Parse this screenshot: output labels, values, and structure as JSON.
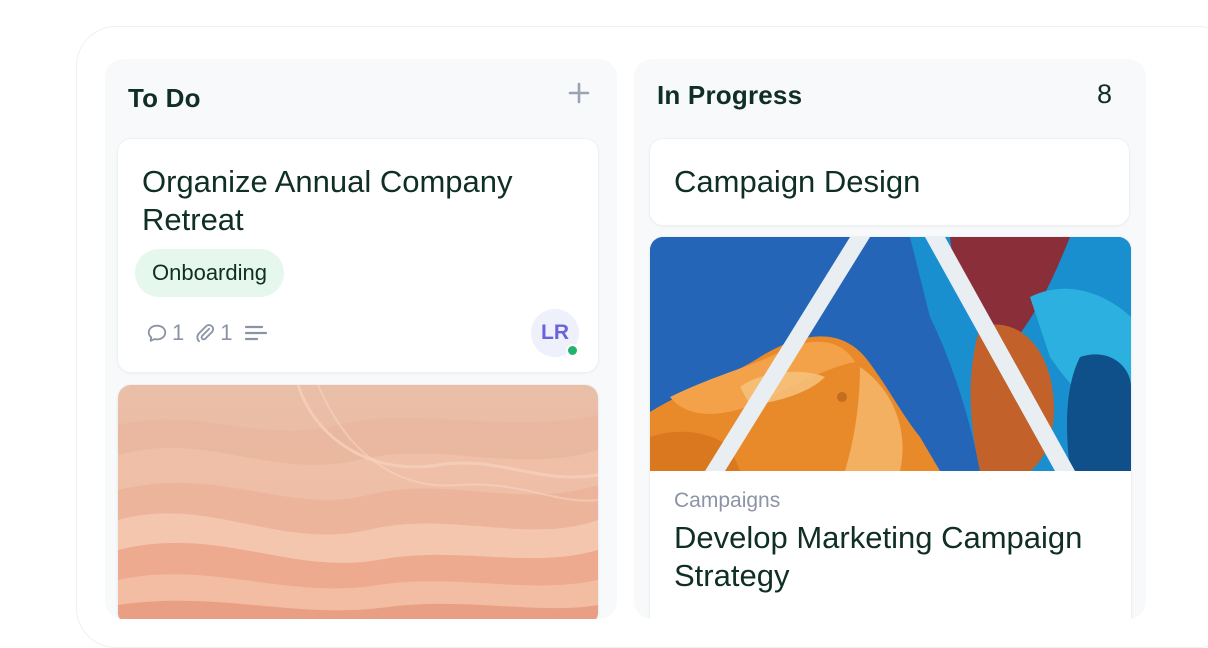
{
  "columns": [
    {
      "title": "To Do",
      "add_icon": "plus-icon",
      "cards": [
        {
          "title": "Organize Annual Company Retreat",
          "tag": "Onboarding",
          "comments": "1",
          "attachments": "1",
          "assignee_initials": "LR",
          "assignee_status_color": "#21b36b"
        },
        {
          "image": "peach-waves-image"
        }
      ]
    },
    {
      "title": "In Progress",
      "count": "8",
      "cards": [
        {
          "title": "Campaign Design"
        },
        {
          "image": "colorful-mural-image",
          "category": "Campaigns",
          "title": "Develop Marketing Campaign Strategy"
        }
      ]
    }
  ],
  "colors": {
    "text_primary": "#0f2e24",
    "text_muted": "#8a94a6",
    "tag_bg": "#e6f7ee",
    "avatar_bg": "#eef0fb",
    "avatar_text": "#6a63d9",
    "column_bg": "#f7f9fb"
  }
}
